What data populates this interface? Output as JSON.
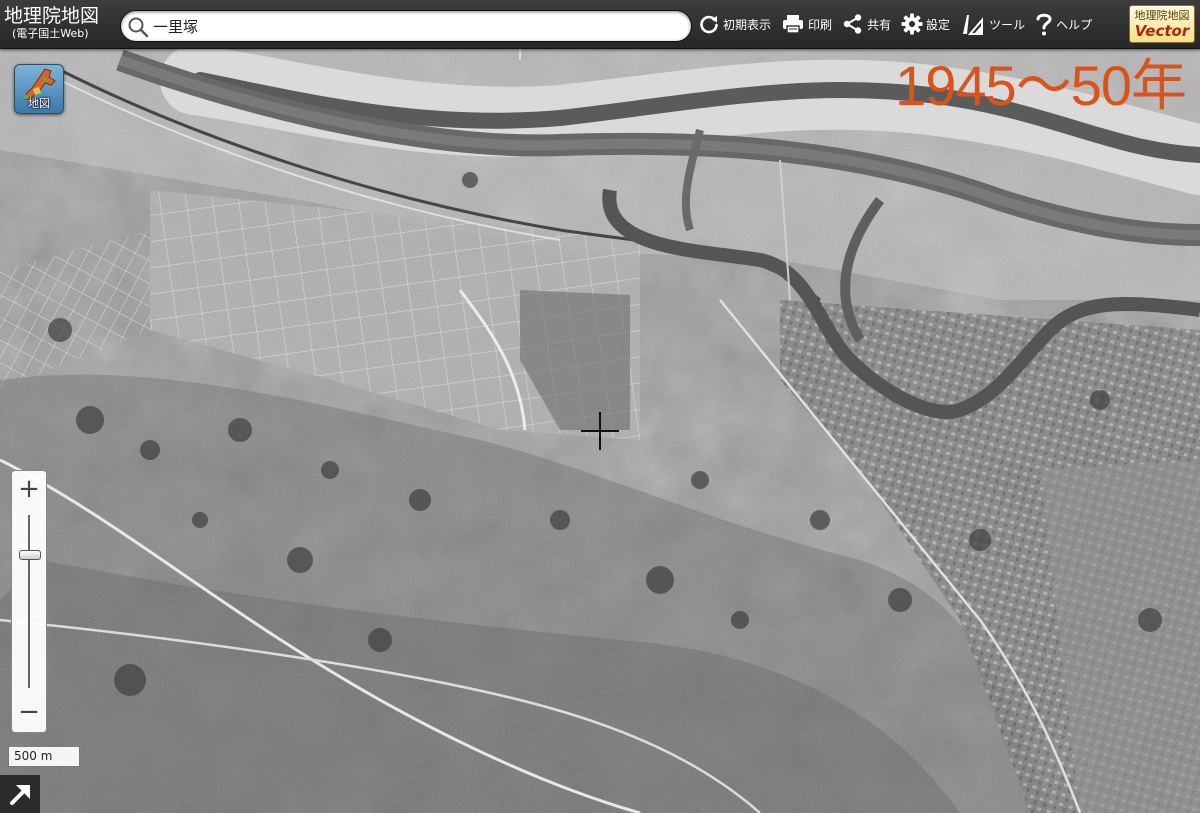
{
  "app": {
    "title": "地理院地図",
    "subtitle": "(電子国土Web)"
  },
  "search": {
    "value": "一里塚",
    "icon": "search-icon"
  },
  "toolbar": {
    "items": [
      {
        "label": "初期表示",
        "icon": "reload-icon"
      },
      {
        "label": "印刷",
        "icon": "printer-icon"
      },
      {
        "label": "共有",
        "icon": "share-icon"
      },
      {
        "label": "設定",
        "icon": "gear-icon"
      },
      {
        "label": "ツール",
        "icon": "tools-icon"
      },
      {
        "label": "ヘルプ",
        "icon": "help-icon"
      }
    ],
    "vector": {
      "line1": "地理院地図",
      "line2": "Vector"
    }
  },
  "layer_button": {
    "label": "地図"
  },
  "era_label": "1945〜50年",
  "zoom": {
    "in": "+",
    "out": "−"
  },
  "scale": {
    "label": "500 m"
  },
  "colors": {
    "header": "#2e2e2e",
    "era_label": "#d9541b",
    "vector_text": "#b0270f",
    "map_tone": "#9c9c9c"
  }
}
